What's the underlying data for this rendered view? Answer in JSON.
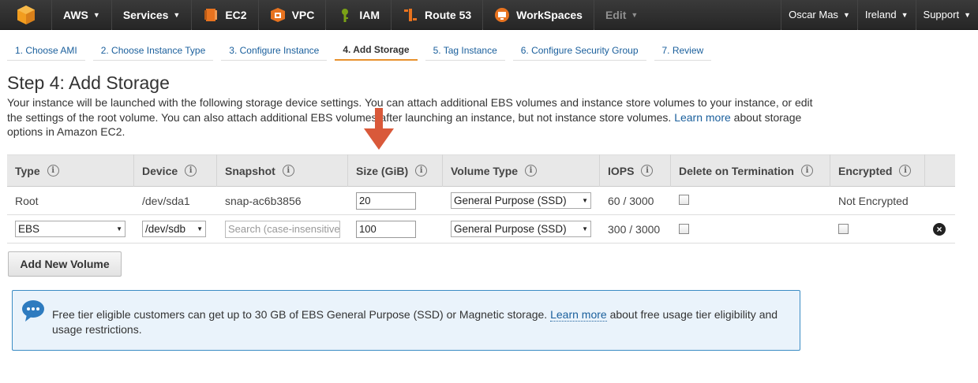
{
  "nav": {
    "logo": "aws-logo",
    "aws_label": "AWS",
    "services_label": "Services",
    "shortcuts": [
      {
        "label": "EC2",
        "icon": "ec2-icon",
        "color": "#e8731f"
      },
      {
        "label": "VPC",
        "icon": "vpc-icon",
        "color": "#e8731f"
      },
      {
        "label": "IAM",
        "icon": "iam-icon",
        "color": "#7aa116"
      },
      {
        "label": "Route 53",
        "icon": "route53-icon",
        "color": "#e8731f"
      },
      {
        "label": "WorkSpaces",
        "icon": "workspaces-icon",
        "color": "#e8731f"
      }
    ],
    "edit_label": "Edit",
    "user_label": "Oscar Mas",
    "region_label": "Ireland",
    "support_label": "Support"
  },
  "wizard": {
    "steps": [
      "1. Choose AMI",
      "2. Choose Instance Type",
      "3. Configure Instance",
      "4. Add Storage",
      "5. Tag Instance",
      "6. Configure Security Group",
      "7. Review"
    ],
    "active_step": "4. Add Storage"
  },
  "page": {
    "title": "Step 4: Add Storage",
    "intro_text": "Your instance will be launched with the following storage device settings. You can attach additional EBS volumes and instance store volumes to your instance, or edit the settings of the root volume. You can also attach additional EBS volumes after launching an instance, but not instance store volumes.",
    "learn_more": "Learn more",
    "intro_tail": "about storage options in Amazon EC2."
  },
  "table": {
    "columns": [
      "Type",
      "Device",
      "Snapshot",
      "Size (GiB)",
      "Volume Type",
      "IOPS",
      "Delete on Termination",
      "Encrypted"
    ],
    "rows": [
      {
        "type": "Root",
        "device": "/dev/sda1",
        "snapshot": "snap-ac6b3856",
        "size": "20",
        "volume_type": "General Purpose (SSD)",
        "iops": "60 / 3000",
        "delete_on_termination": false,
        "encrypted": "Not Encrypted"
      },
      {
        "type": "EBS",
        "device": "/dev/sdb",
        "snapshot_placeholder": "Search (case-insensitive)",
        "size": "100",
        "volume_type": "General Purpose (SSD)",
        "iops": "300 / 3000",
        "delete_on_termination": false,
        "encrypted": false
      }
    ]
  },
  "add_volume_label": "Add New Volume",
  "info": {
    "text": "Free tier eligible customers can get up to 30 GB of EBS General Purpose (SSD) or Magnetic storage.",
    "learn_more": "Learn more",
    "tail": "about free usage tier eligibility and usage restrictions."
  },
  "colors": {
    "nav_bg": "#2b2b2b",
    "link": "#1a5f9c",
    "active_tab": "#e8912d",
    "arrow": "#d9593a",
    "info_border": "#3b8cc4",
    "info_bg": "#eaf3fb"
  }
}
